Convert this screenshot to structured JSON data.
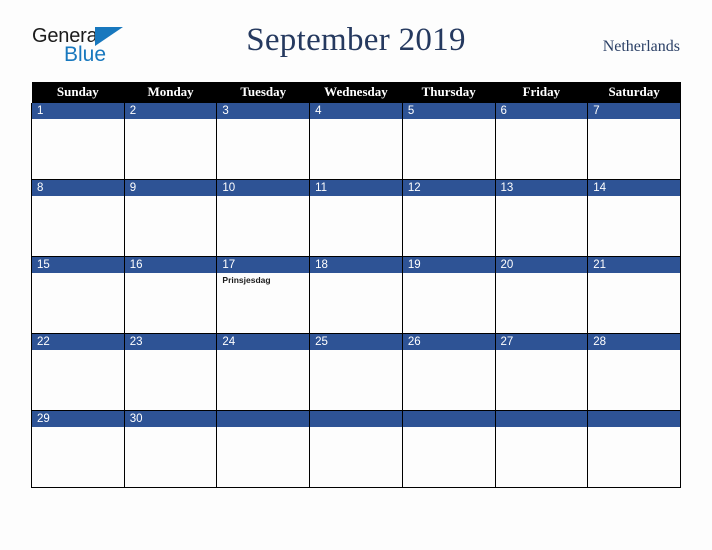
{
  "brand": {
    "name_part1": "General",
    "name_part2": "Blue",
    "triangle_color": "#1878be",
    "text_color": "#1b1b1b"
  },
  "header": {
    "title": "September 2019",
    "country": "Netherlands",
    "title_color": "#25395f"
  },
  "calendar": {
    "weekday_headers": [
      "Sunday",
      "Monday",
      "Tuesday",
      "Wednesday",
      "Thursday",
      "Friday",
      "Saturday"
    ],
    "header_bg": "#000000",
    "header_text": "#ffffff",
    "daybar_bg": "#2e5395",
    "daybar_text": "#ffffff",
    "cell_bg": "#fdfdfd",
    "grid_color": "#000000",
    "weeks": [
      [
        {
          "day": "1",
          "events": []
        },
        {
          "day": "2",
          "events": []
        },
        {
          "day": "3",
          "events": []
        },
        {
          "day": "4",
          "events": []
        },
        {
          "day": "5",
          "events": []
        },
        {
          "day": "6",
          "events": []
        },
        {
          "day": "7",
          "events": []
        }
      ],
      [
        {
          "day": "8",
          "events": []
        },
        {
          "day": "9",
          "events": []
        },
        {
          "day": "10",
          "events": []
        },
        {
          "day": "11",
          "events": []
        },
        {
          "day": "12",
          "events": []
        },
        {
          "day": "13",
          "events": []
        },
        {
          "day": "14",
          "events": []
        }
      ],
      [
        {
          "day": "15",
          "events": []
        },
        {
          "day": "16",
          "events": []
        },
        {
          "day": "17",
          "events": [
            "Prinsjesdag"
          ]
        },
        {
          "day": "18",
          "events": []
        },
        {
          "day": "19",
          "events": []
        },
        {
          "day": "20",
          "events": []
        },
        {
          "day": "21",
          "events": []
        }
      ],
      [
        {
          "day": "22",
          "events": []
        },
        {
          "day": "23",
          "events": []
        },
        {
          "day": "24",
          "events": []
        },
        {
          "day": "25",
          "events": []
        },
        {
          "day": "26",
          "events": []
        },
        {
          "day": "27",
          "events": []
        },
        {
          "day": "28",
          "events": []
        }
      ],
      [
        {
          "day": "29",
          "events": []
        },
        {
          "day": "30",
          "events": []
        },
        {
          "day": "",
          "events": []
        },
        {
          "day": "",
          "events": []
        },
        {
          "day": "",
          "events": []
        },
        {
          "day": "",
          "events": []
        },
        {
          "day": "",
          "events": []
        }
      ]
    ]
  }
}
